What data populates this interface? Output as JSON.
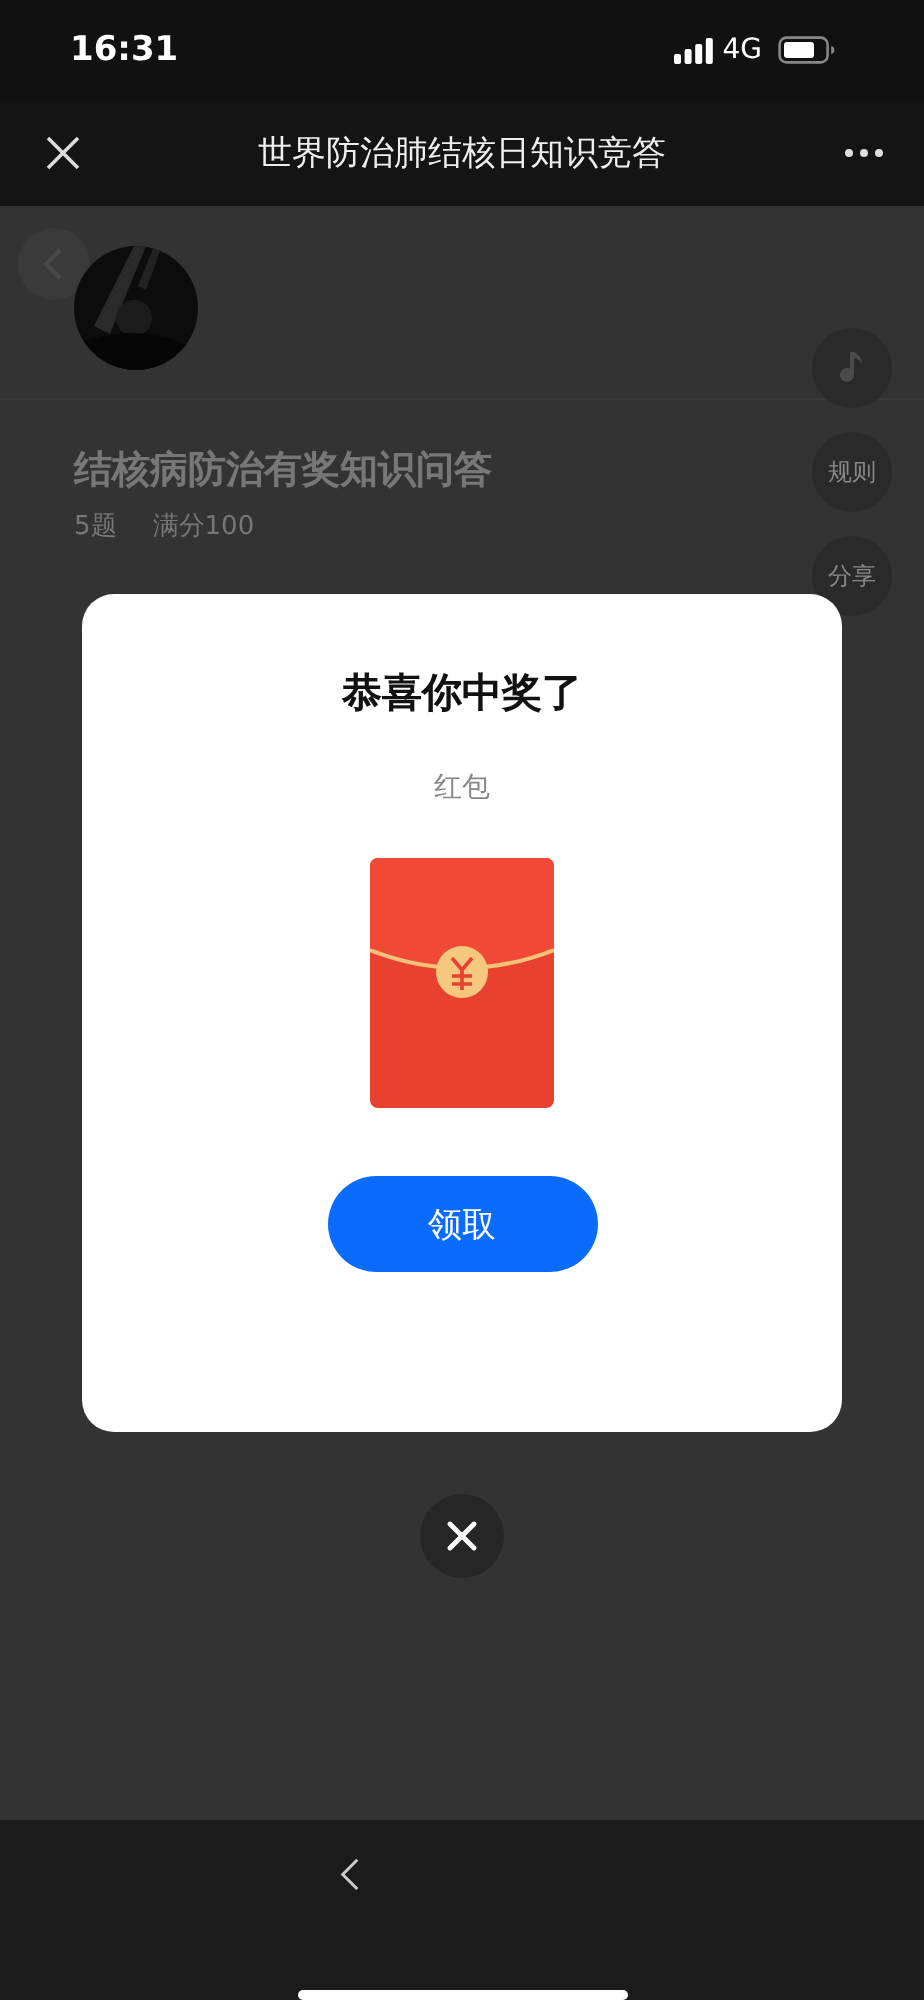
{
  "status_bar": {
    "time": "16:31",
    "network": "4G"
  },
  "nav_bar": {
    "title": "世界防治肺结核日知识竞答"
  },
  "page": {
    "title": "结核病防治有奖知识问答",
    "meta": [
      "5题",
      "满分100"
    ],
    "side_buttons": [
      {
        "kind": "icon"
      },
      {
        "kind": "text",
        "label": "规则"
      },
      {
        "kind": "text",
        "label": "分享"
      }
    ]
  },
  "dialog": {
    "title": "恭喜你中奖了",
    "prize": "红包",
    "button": "领取"
  }
}
